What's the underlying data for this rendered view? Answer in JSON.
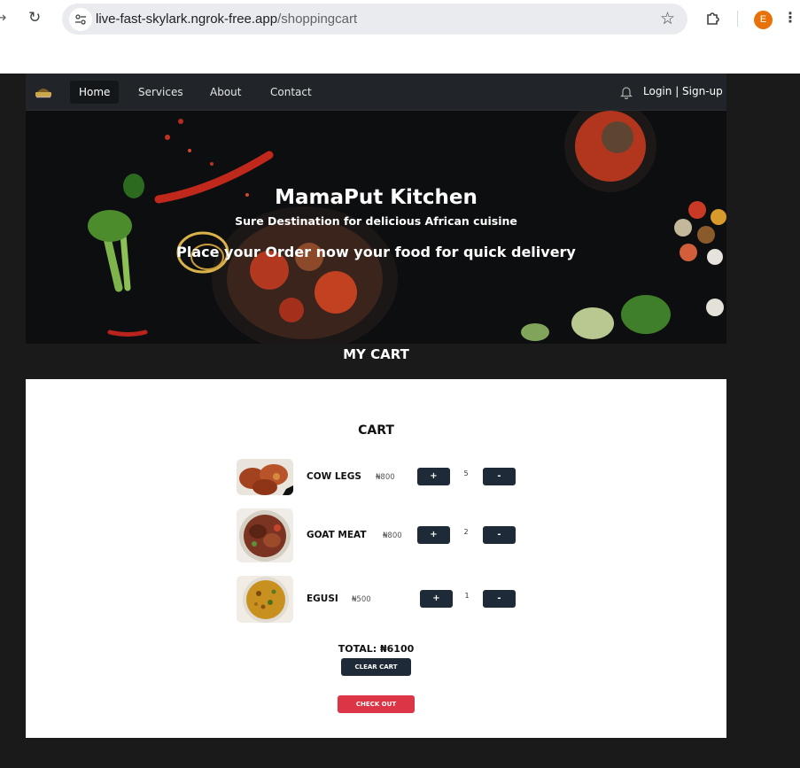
{
  "browser": {
    "url_host": "live-fast-skylark.ngrok-free.app",
    "url_path": "/shoppingcart",
    "profile_initial": "E",
    "profile_color": "#e8710a"
  },
  "nav": {
    "items": [
      {
        "label": "Home",
        "active": true
      },
      {
        "label": "Services",
        "active": false
      },
      {
        "label": "About",
        "active": false
      },
      {
        "label": "Contact",
        "active": false
      }
    ],
    "login_label": "Login | Sign-up"
  },
  "hero": {
    "title": "MamaPut Kitchen",
    "subtitle": "Sure Destination for delicious African cuisine",
    "cta": "Place your Order now your food for quick delivery"
  },
  "my_cart_heading": "MY CART",
  "cart": {
    "heading": "CART",
    "items": [
      {
        "name": "COW LEGS",
        "price": "₦800",
        "quantity": "5",
        "plus_label": "+",
        "minus_label": "-"
      },
      {
        "name": "GOAT MEAT",
        "price": "₦800",
        "quantity": "2",
        "plus_label": "+",
        "minus_label": "-"
      },
      {
        "name": "EGUSI",
        "price": "₦500",
        "quantity": "1",
        "plus_label": "+",
        "minus_label": "-"
      }
    ],
    "total": "TOTAL: ₦6100",
    "clear_label": "CLEAR CART",
    "checkout_label": "CHECK OUT"
  },
  "colors": {
    "navbar": "#212529",
    "button_dark": "#1f2a38",
    "checkout": "#dc3545",
    "page_bg": "#1a1a1a"
  }
}
